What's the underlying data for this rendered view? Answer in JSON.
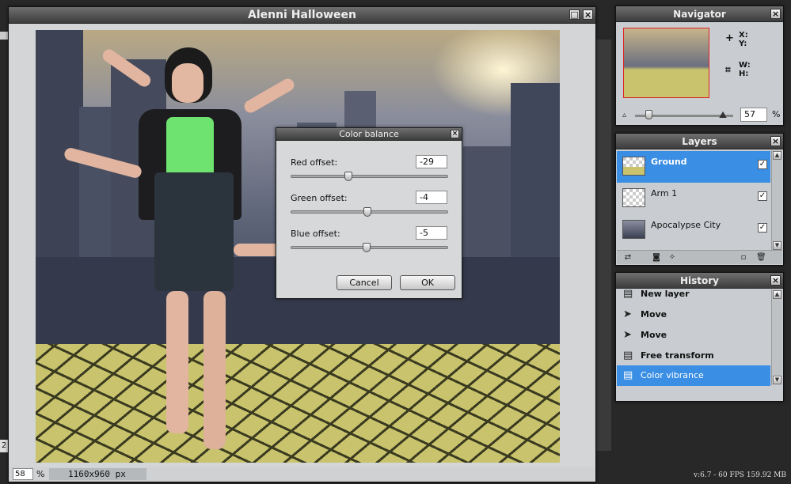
{
  "document": {
    "title": "Alenni Halloween",
    "zoom_value": "58",
    "zoom_unit": "%",
    "dimensions": "1160x960 px"
  },
  "dialog": {
    "title": "Color balance",
    "red_label": "Red offset:",
    "red_value": "-29",
    "green_label": "Green offset:",
    "green_value": "-4",
    "blue_label": "Blue offset:",
    "blue_value": "-5",
    "slider_range": [
      -100,
      100
    ],
    "cancel_label": "Cancel",
    "ok_label": "OK"
  },
  "navigator": {
    "title": "Navigator",
    "x_label": "X:",
    "y_label": "Y:",
    "w_label": "W:",
    "h_label": "H:",
    "zoom_value": "57",
    "zoom_unit": "%"
  },
  "layers": {
    "title": "Layers",
    "items": [
      {
        "name": "Ground",
        "selected": true,
        "visible": true
      },
      {
        "name": "Arm 1",
        "selected": false,
        "visible": true
      },
      {
        "name": "Apocalypse City",
        "selected": false,
        "visible": true
      }
    ]
  },
  "history": {
    "title": "History",
    "items": [
      {
        "label": "New layer",
        "icon": "document-icon",
        "selected": false
      },
      {
        "label": "Move",
        "icon": "move-arrow-icon",
        "selected": false
      },
      {
        "label": "Move",
        "icon": "move-arrow-icon",
        "selected": false
      },
      {
        "label": "Free transform",
        "icon": "document-icon",
        "selected": false
      },
      {
        "label": "Color vibrance",
        "icon": "document-icon",
        "selected": true
      }
    ]
  },
  "footer": {
    "fps_text": "v:6.7 - 60 FPS 159.92 MB",
    "left_edge_text": "2"
  },
  "colors": {
    "selection": "#3a8ee3",
    "navigator_frame": "#dd2222"
  }
}
